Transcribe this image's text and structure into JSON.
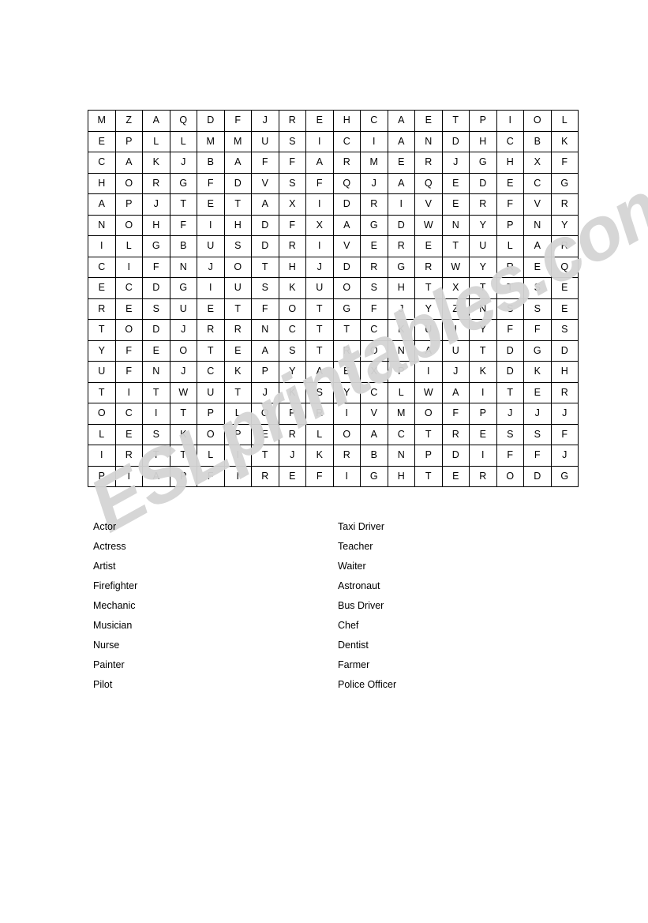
{
  "document": {
    "type": "word-search-worksheet",
    "topic": "Jobs and Occupations"
  },
  "watermark": {
    "text": "ESLprintables.com",
    "color": "#d4d4d4"
  },
  "grid": {
    "rows": 18,
    "columns": 18,
    "border_color": "#000000",
    "letters": [
      [
        "M",
        "Z",
        "A",
        "Q",
        "D",
        "F",
        "J",
        "R",
        "E",
        "H",
        "C",
        "A",
        "E",
        "T",
        "P",
        "I",
        "O",
        "L"
      ],
      [
        "E",
        "P",
        "L",
        "L",
        "M",
        "M",
        "U",
        "S",
        "I",
        "C",
        "I",
        "A",
        "N",
        "D",
        "H",
        "C",
        "B",
        "K"
      ],
      [
        "C",
        "A",
        "K",
        "J",
        "B",
        "A",
        "F",
        "F",
        "A",
        "R",
        "M",
        "E",
        "R",
        "J",
        "G",
        "H",
        "X",
        "F"
      ],
      [
        "H",
        "O",
        "R",
        "G",
        "F",
        "D",
        "V",
        "S",
        "F",
        "Q",
        "J",
        "A",
        "Q",
        "E",
        "D",
        "E",
        "C",
        "G"
      ],
      [
        "A",
        "P",
        "J",
        "T",
        "E",
        "T",
        "A",
        "X",
        "I",
        "D",
        "R",
        "I",
        "V",
        "E",
        "R",
        "F",
        "V",
        "R"
      ],
      [
        "N",
        "O",
        "H",
        "F",
        "I",
        "H",
        "D",
        "F",
        "X",
        "A",
        "G",
        "D",
        "W",
        "N",
        "Y",
        "P",
        "N",
        "Y"
      ],
      [
        "I",
        "L",
        "G",
        "B",
        "U",
        "S",
        "D",
        "R",
        "I",
        "V",
        "E",
        "R",
        "E",
        "T",
        "U",
        "L",
        "A",
        "R"
      ],
      [
        "C",
        "I",
        "F",
        "N",
        "J",
        "O",
        "T",
        "H",
        "J",
        "D",
        "R",
        "G",
        "R",
        "W",
        "Y",
        "R",
        "E",
        "Q"
      ],
      [
        "E",
        "C",
        "D",
        "G",
        "I",
        "U",
        "S",
        "K",
        "U",
        "O",
        "S",
        "H",
        "T",
        "X",
        "T",
        "T",
        "S",
        "E"
      ],
      [
        "R",
        "E",
        "S",
        "U",
        "E",
        "T",
        "F",
        "O",
        "T",
        "G",
        "F",
        "J",
        "Y",
        "Z",
        "N",
        "S",
        "S",
        "E"
      ],
      [
        "T",
        "O",
        "D",
        "J",
        "R",
        "R",
        "N",
        "C",
        "T",
        "T",
        "C",
        "K",
        "U",
        "I",
        "Y",
        "F",
        "F",
        "S"
      ],
      [
        "Y",
        "F",
        "E",
        "O",
        "T",
        "E",
        "A",
        "S",
        "T",
        "R",
        "O",
        "N",
        "A",
        "U",
        "T",
        "D",
        "G",
        "D"
      ],
      [
        "U",
        "F",
        "N",
        "J",
        "C",
        "K",
        "P",
        "Y",
        "A",
        "E",
        "X",
        "P",
        "I",
        "J",
        "K",
        "D",
        "K",
        "H"
      ],
      [
        "T",
        "I",
        "T",
        "W",
        "U",
        "T",
        "J",
        "K",
        "S",
        "Y",
        "C",
        "L",
        "W",
        "A",
        "I",
        "T",
        "E",
        "R"
      ],
      [
        "O",
        "C",
        "I",
        "T",
        "P",
        "L",
        "O",
        "P",
        "R",
        "I",
        "V",
        "M",
        "O",
        "F",
        "P",
        "J",
        "J",
        "J"
      ],
      [
        "L",
        "E",
        "S",
        "K",
        "O",
        "P",
        "E",
        "R",
        "L",
        "O",
        "A",
        "C",
        "T",
        "R",
        "E",
        "S",
        "S",
        "F"
      ],
      [
        "I",
        "R",
        "T",
        "T",
        "L",
        "I",
        "T",
        "J",
        "K",
        "R",
        "B",
        "N",
        "P",
        "D",
        "I",
        "F",
        "F",
        "J"
      ],
      [
        "P",
        "I",
        "A",
        "P",
        "F",
        "I",
        "R",
        "E",
        "F",
        "I",
        "G",
        "H",
        "T",
        "E",
        "R",
        "O",
        "D",
        "G"
      ]
    ]
  },
  "word_lists": {
    "left": [
      "Actor",
      "Actress",
      "Artist",
      "Firefighter",
      "Mechanic",
      "Musician",
      "Nurse",
      "Painter",
      "Pilot"
    ],
    "right": [
      "Taxi Driver",
      "Teacher",
      "Waiter",
      "Astronaut",
      "Bus Driver",
      "Chef",
      "Dentist",
      "Farmer",
      "Police Officer"
    ]
  }
}
